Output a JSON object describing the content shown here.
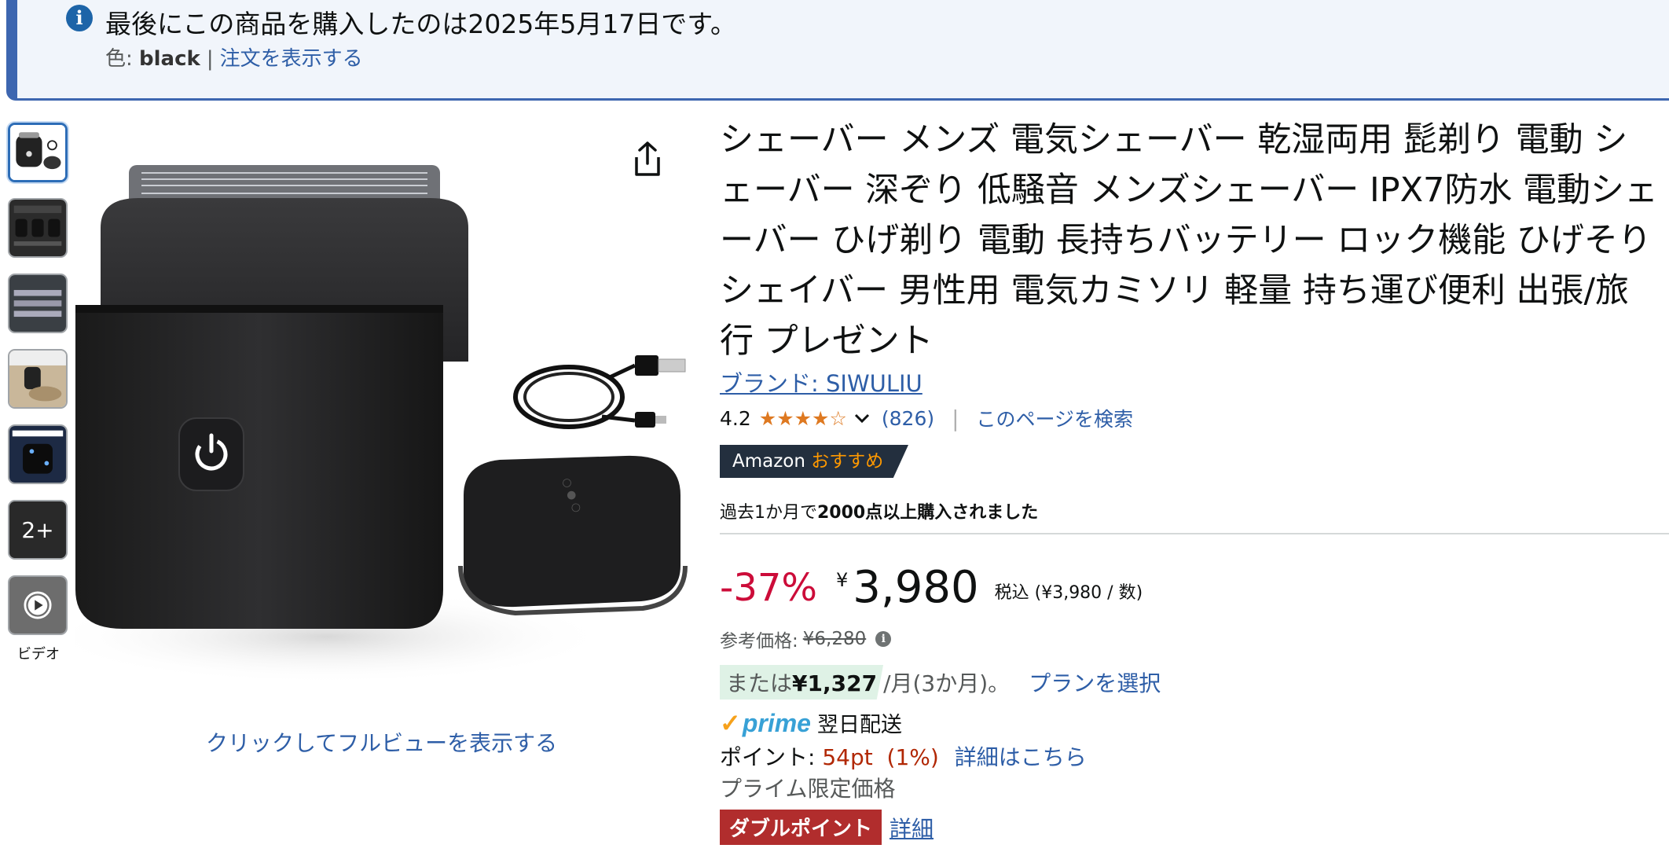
{
  "notice": {
    "message": "最後にこの商品を購入したのは2025年5月17日です。",
    "color_label": "色: ",
    "color_value": "black",
    "separator": "|",
    "view_order_link": "注文を表示する"
  },
  "gallery": {
    "thumbnails": [
      {
        "kind": "image",
        "selected": true
      },
      {
        "kind": "image",
        "selected": false
      },
      {
        "kind": "image",
        "selected": false
      },
      {
        "kind": "image",
        "selected": false
      },
      {
        "kind": "image",
        "selected": false
      },
      {
        "kind": "more",
        "label": "2+"
      },
      {
        "kind": "video",
        "icon": "play-icon"
      }
    ],
    "video_label": "ビデオ",
    "fullview_link": "クリックしてフルビューを表示する",
    "share_icon": "share-icon"
  },
  "product": {
    "title": "シェーバー メンズ 電気シェーバー 乾湿両用 髭剃り 電動 シェーバー 深ぞり 低騒音 メンズシェーバー IPX7防水 電動シェーバー ひげ剃り 電動 長持ちバッテリー ロック機能 ひげそり シェイバー 男性用 電気カミソリ 軽量 持ち運び便利 出張/旅行 プレゼント",
    "brand_link": "ブランド: SIWULIU",
    "rating": "4.2",
    "rating_value": 4.2,
    "rating_max": 5,
    "review_count": "(826)",
    "rating_sep": "|",
    "search_page_link": "このページを検索",
    "badge_amazon": "Amazon",
    "badge_recommend": "おすすめ",
    "bought_prefix": "過去1か月で",
    "bought_bold": "2000点以上購入されました"
  },
  "pricing": {
    "discount": "-37%",
    "currency_symbol": "¥",
    "price": "3,980",
    "tax_note": "税込 (¥3,980 / 数)",
    "list_price_label": "参考価格:",
    "list_price": "¥6,280",
    "installment_prefix": "または",
    "installment_amount": "¥1,327",
    "installment_suffix": "/月(3か月)。",
    "plan_link": "プランを選択",
    "prime_label": "prime",
    "delivery": "翌日配送",
    "points_label": "ポイント: ",
    "points_value": "54pt  (1%)",
    "points_link": "詳細はこちら",
    "prime_limited": "プライム限定価格",
    "double_points": "ダブルポイント",
    "double_link": "詳細"
  },
  "colors": {
    "accent_blue": "#2e5ea7",
    "banner_border": "#3d66b0",
    "discount_red": "#cc0c39",
    "star_orange": "#de7921",
    "badge_dark": "#232f3e",
    "double_red": "#b12d2d"
  }
}
